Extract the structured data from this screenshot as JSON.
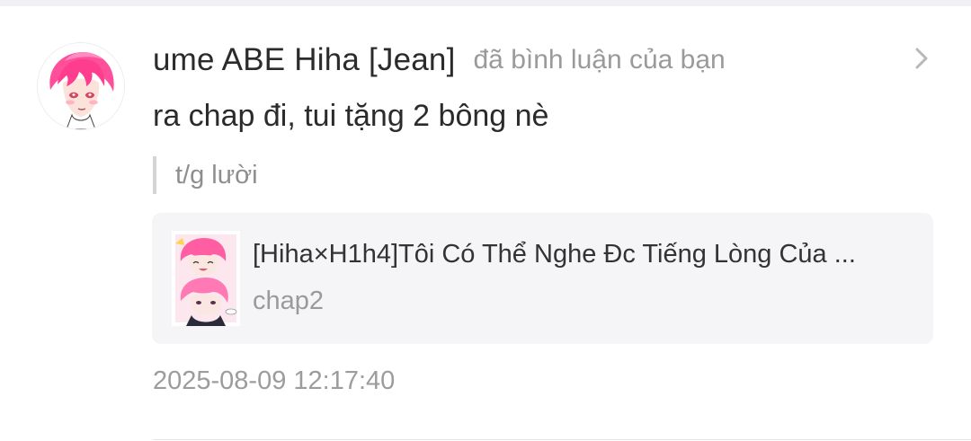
{
  "notification": {
    "username": "ume ABE Hiha [Jean]",
    "action_text": "đã bình luận của bạn",
    "comment": "ra chap đi, tui tặng 2 bông nè",
    "quoted_reply": "t/g lười",
    "timestamp": "2025-08-09 12:17:40",
    "icons": {
      "avatar": "avatar-image",
      "open": "chevron-right-icon",
      "cover": "comic-cover-image"
    }
  },
  "linked_work": {
    "title": "[Hiha×H1h4]Tôi Có Thể Nghe Đc Tiếng Lòng Của ...",
    "chapter": "chap2"
  },
  "colors": {
    "accent_hair": "#ff5fa2",
    "text_primary": "#2b2b2b",
    "text_secondary": "#9a9a9a",
    "card_background": "#f5f5f7"
  }
}
